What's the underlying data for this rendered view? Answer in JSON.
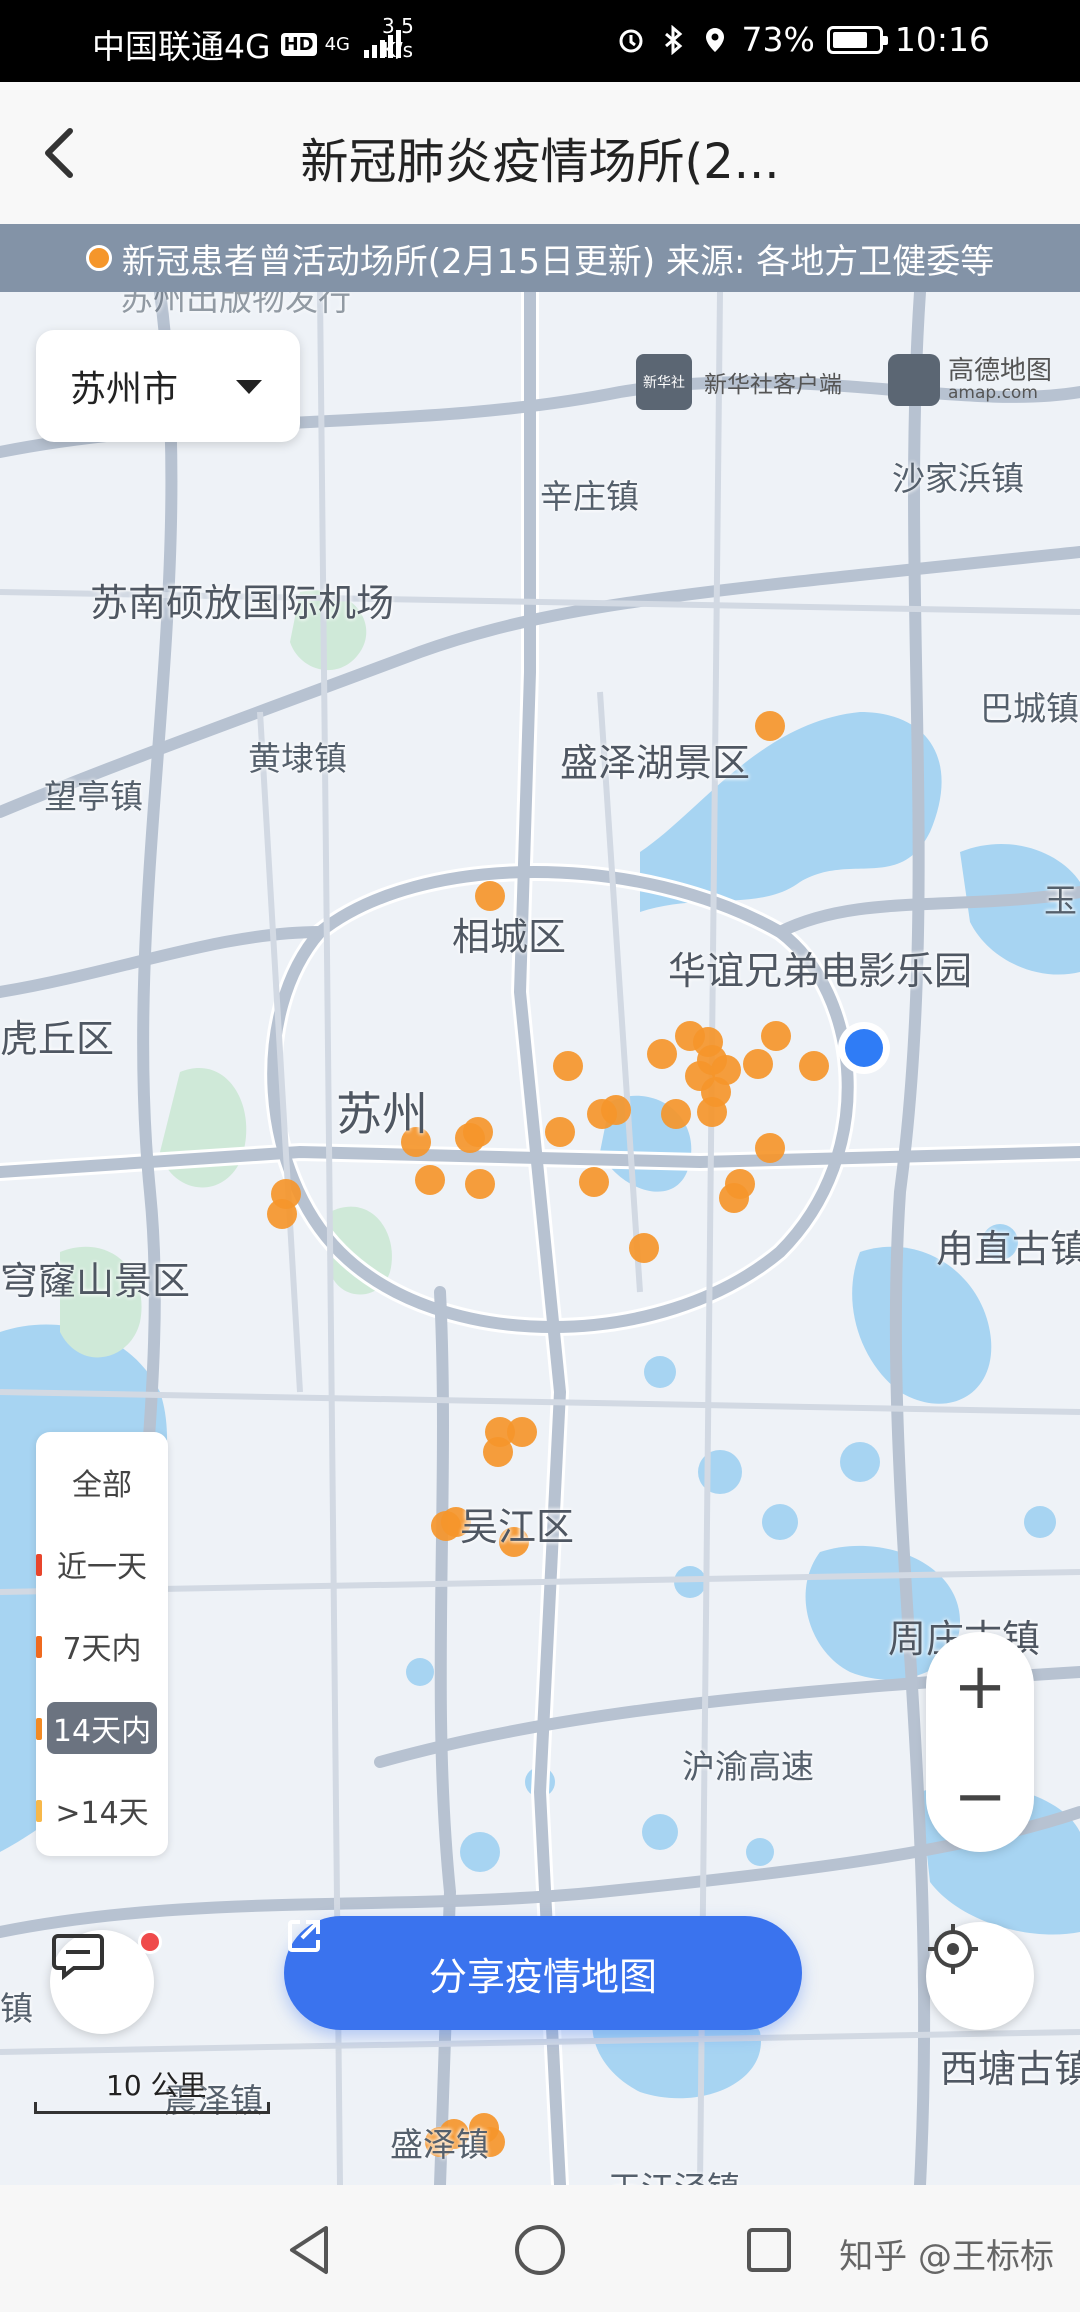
{
  "status_bar": {
    "carrier": "中国联通4G",
    "hd_badge": "HD",
    "net_type": "4G",
    "speed_value": "3.5",
    "speed_unit": "K/s",
    "battery": "73%",
    "time": "10:16"
  },
  "header": {
    "title": "新冠肺炎疫情场所(2..."
  },
  "banner": {
    "text": "新冠患者曾活动场所(2月15日更新) 来源: 各地方卫健委等",
    "dot_color": "#f5962b"
  },
  "map": {
    "city_select": "苏州市",
    "logos": {
      "xinhua_mark": "新华社",
      "xinhua_name": "新华社客户端",
      "amap_name": "高德地图",
      "amap_url": "amap.com"
    },
    "labels": {
      "top_cut": "苏州出版物发行",
      "sha": "沙家浜镇",
      "xinzhuang": "辛庄镇",
      "airport": "苏南硕放国际机场",
      "bacheng": "巴城镇",
      "huangdai": "黄埭镇",
      "shengzehu": "盛泽湖景区",
      "wangting": "望亭镇",
      "xiangcheng": "相城区",
      "yu": "玉",
      "huayi": "华谊兄弟电影乐园",
      "huqiu": "虎丘区",
      "suzhou": "苏州",
      "luzhi": "甪直古镇",
      "qiongshan": "穹窿山景区",
      "wujiang": "吴江区",
      "zhouzhuang": "周庄古镇",
      "huyu": "沪渝高速",
      "zhen": "镇",
      "shengze": "盛泽镇",
      "zhenze": "震泽镇",
      "xitang": "西塘古镇",
      "wangjiang": "王江泾镇"
    },
    "filters": [
      {
        "label": "全部",
        "color": ""
      },
      {
        "label": "近一天",
        "color": "#e8452c"
      },
      {
        "label": "7天内",
        "color": "#ef6a1f"
      },
      {
        "label": "14天内",
        "color": "#f28a24"
      },
      {
        "label": ">14天",
        "color": "#f7b84a"
      }
    ],
    "selected_filter": "14天内",
    "zoom_in": "+",
    "zoom_out": "−",
    "share_button": "分享疫情地图",
    "scale": "10 公里",
    "point_color": "#f5962b",
    "my_location_color": "#2f7cf6"
  },
  "watermark": "知乎 @王标标"
}
